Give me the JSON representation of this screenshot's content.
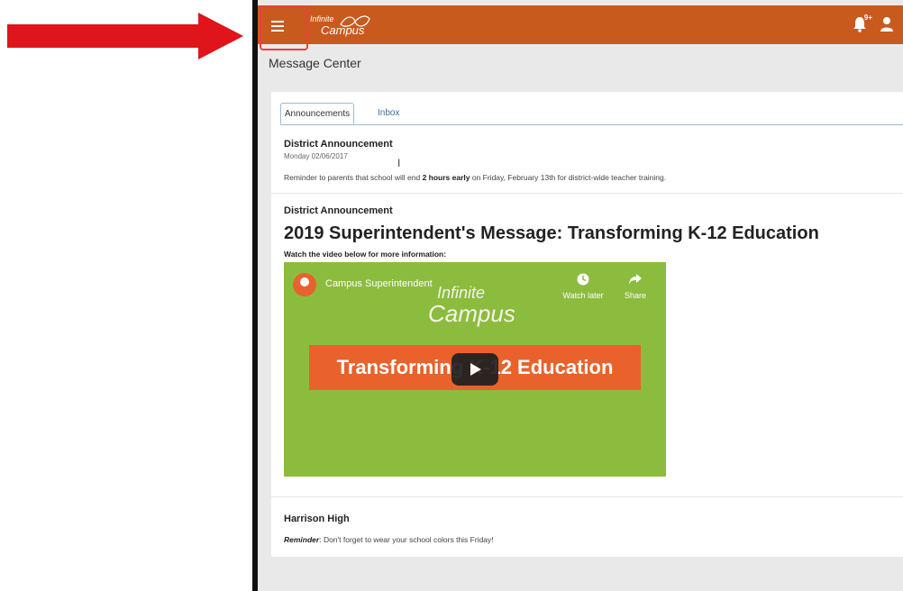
{
  "app": {
    "logo_line1": "Infinite",
    "logo_line2": "Campus",
    "notification_badge": "9+",
    "page_title": "Message Center"
  },
  "tabs": [
    {
      "label": "Announcements",
      "active": true
    },
    {
      "label": "Inbox",
      "active": false
    }
  ],
  "announcements": [
    {
      "title": "District Announcement",
      "date": "Monday 02/06/2017",
      "body_pre": "Reminder to parents that school will end ",
      "body_bold": "2 hours early",
      "body_post": " on Friday, February 13th for district-wide teacher training."
    },
    {
      "title": "District Announcement",
      "headline": "2019 Superintendent's Message: Transforming K-12 Education",
      "subline": "Watch the video below for more information:",
      "video": {
        "channel": "Campus Superintendent",
        "watch_later": "Watch later",
        "share": "Share",
        "brand_line1": "Infinite",
        "brand_line2": "Campus",
        "banner": "Transforming K-12 Education"
      }
    },
    {
      "title": "Harrison High",
      "body_em": "Reminder",
      "body": ": Don't forget to wear your school colors this Friday!"
    }
  ],
  "colors": {
    "topbar": "#c85a1e",
    "annotation_arrow": "#e0141b",
    "video_bg": "#8cbc3e",
    "banner": "#e9622b"
  }
}
